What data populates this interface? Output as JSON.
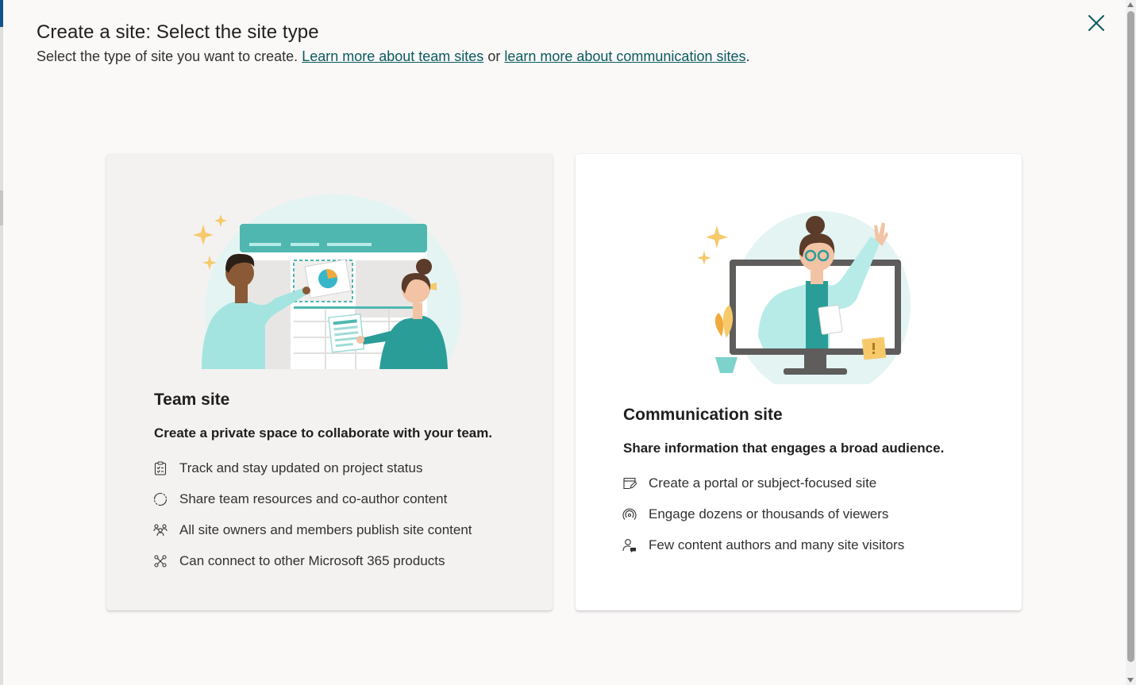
{
  "dialog": {
    "title": "Create a site: Select the site type",
    "subtitle_prefix": "Select the type of site you want to create. ",
    "link_team": "Learn more about team sites",
    "subtitle_or": " or ",
    "link_comm": "learn more about communication sites",
    "subtitle_suffix": ".",
    "close_icon": "close-icon"
  },
  "colors": {
    "accent": "#0b5a5f",
    "teal": "#4fb7b0",
    "teal_light": "#b7ebe8",
    "card_team_bg": "#f3f2f1",
    "card_comm_bg": "#ffffff"
  },
  "team_site": {
    "title": "Team site",
    "description": "Create a private space to collaborate with your team.",
    "features": [
      {
        "icon": "clipboard-checklist-icon",
        "text": "Track and stay updated on project status"
      },
      {
        "icon": "circular-arrows-icon",
        "text": "Share team resources and co-author content"
      },
      {
        "icon": "people-group-icon",
        "text": "All site owners and members publish site content"
      },
      {
        "icon": "connector-icon",
        "text": "Can connect to other Microsoft 365 products"
      }
    ]
  },
  "communication_site": {
    "title": "Communication site",
    "description": "Share information that engages a broad audience.",
    "features": [
      {
        "icon": "page-edit-icon",
        "text": "Create a portal or subject-focused site"
      },
      {
        "icon": "broadcast-icon",
        "text": "Engage dozens or thousands of viewers"
      },
      {
        "icon": "person-feedback-icon",
        "text": "Few content authors and many site visitors"
      }
    ]
  }
}
